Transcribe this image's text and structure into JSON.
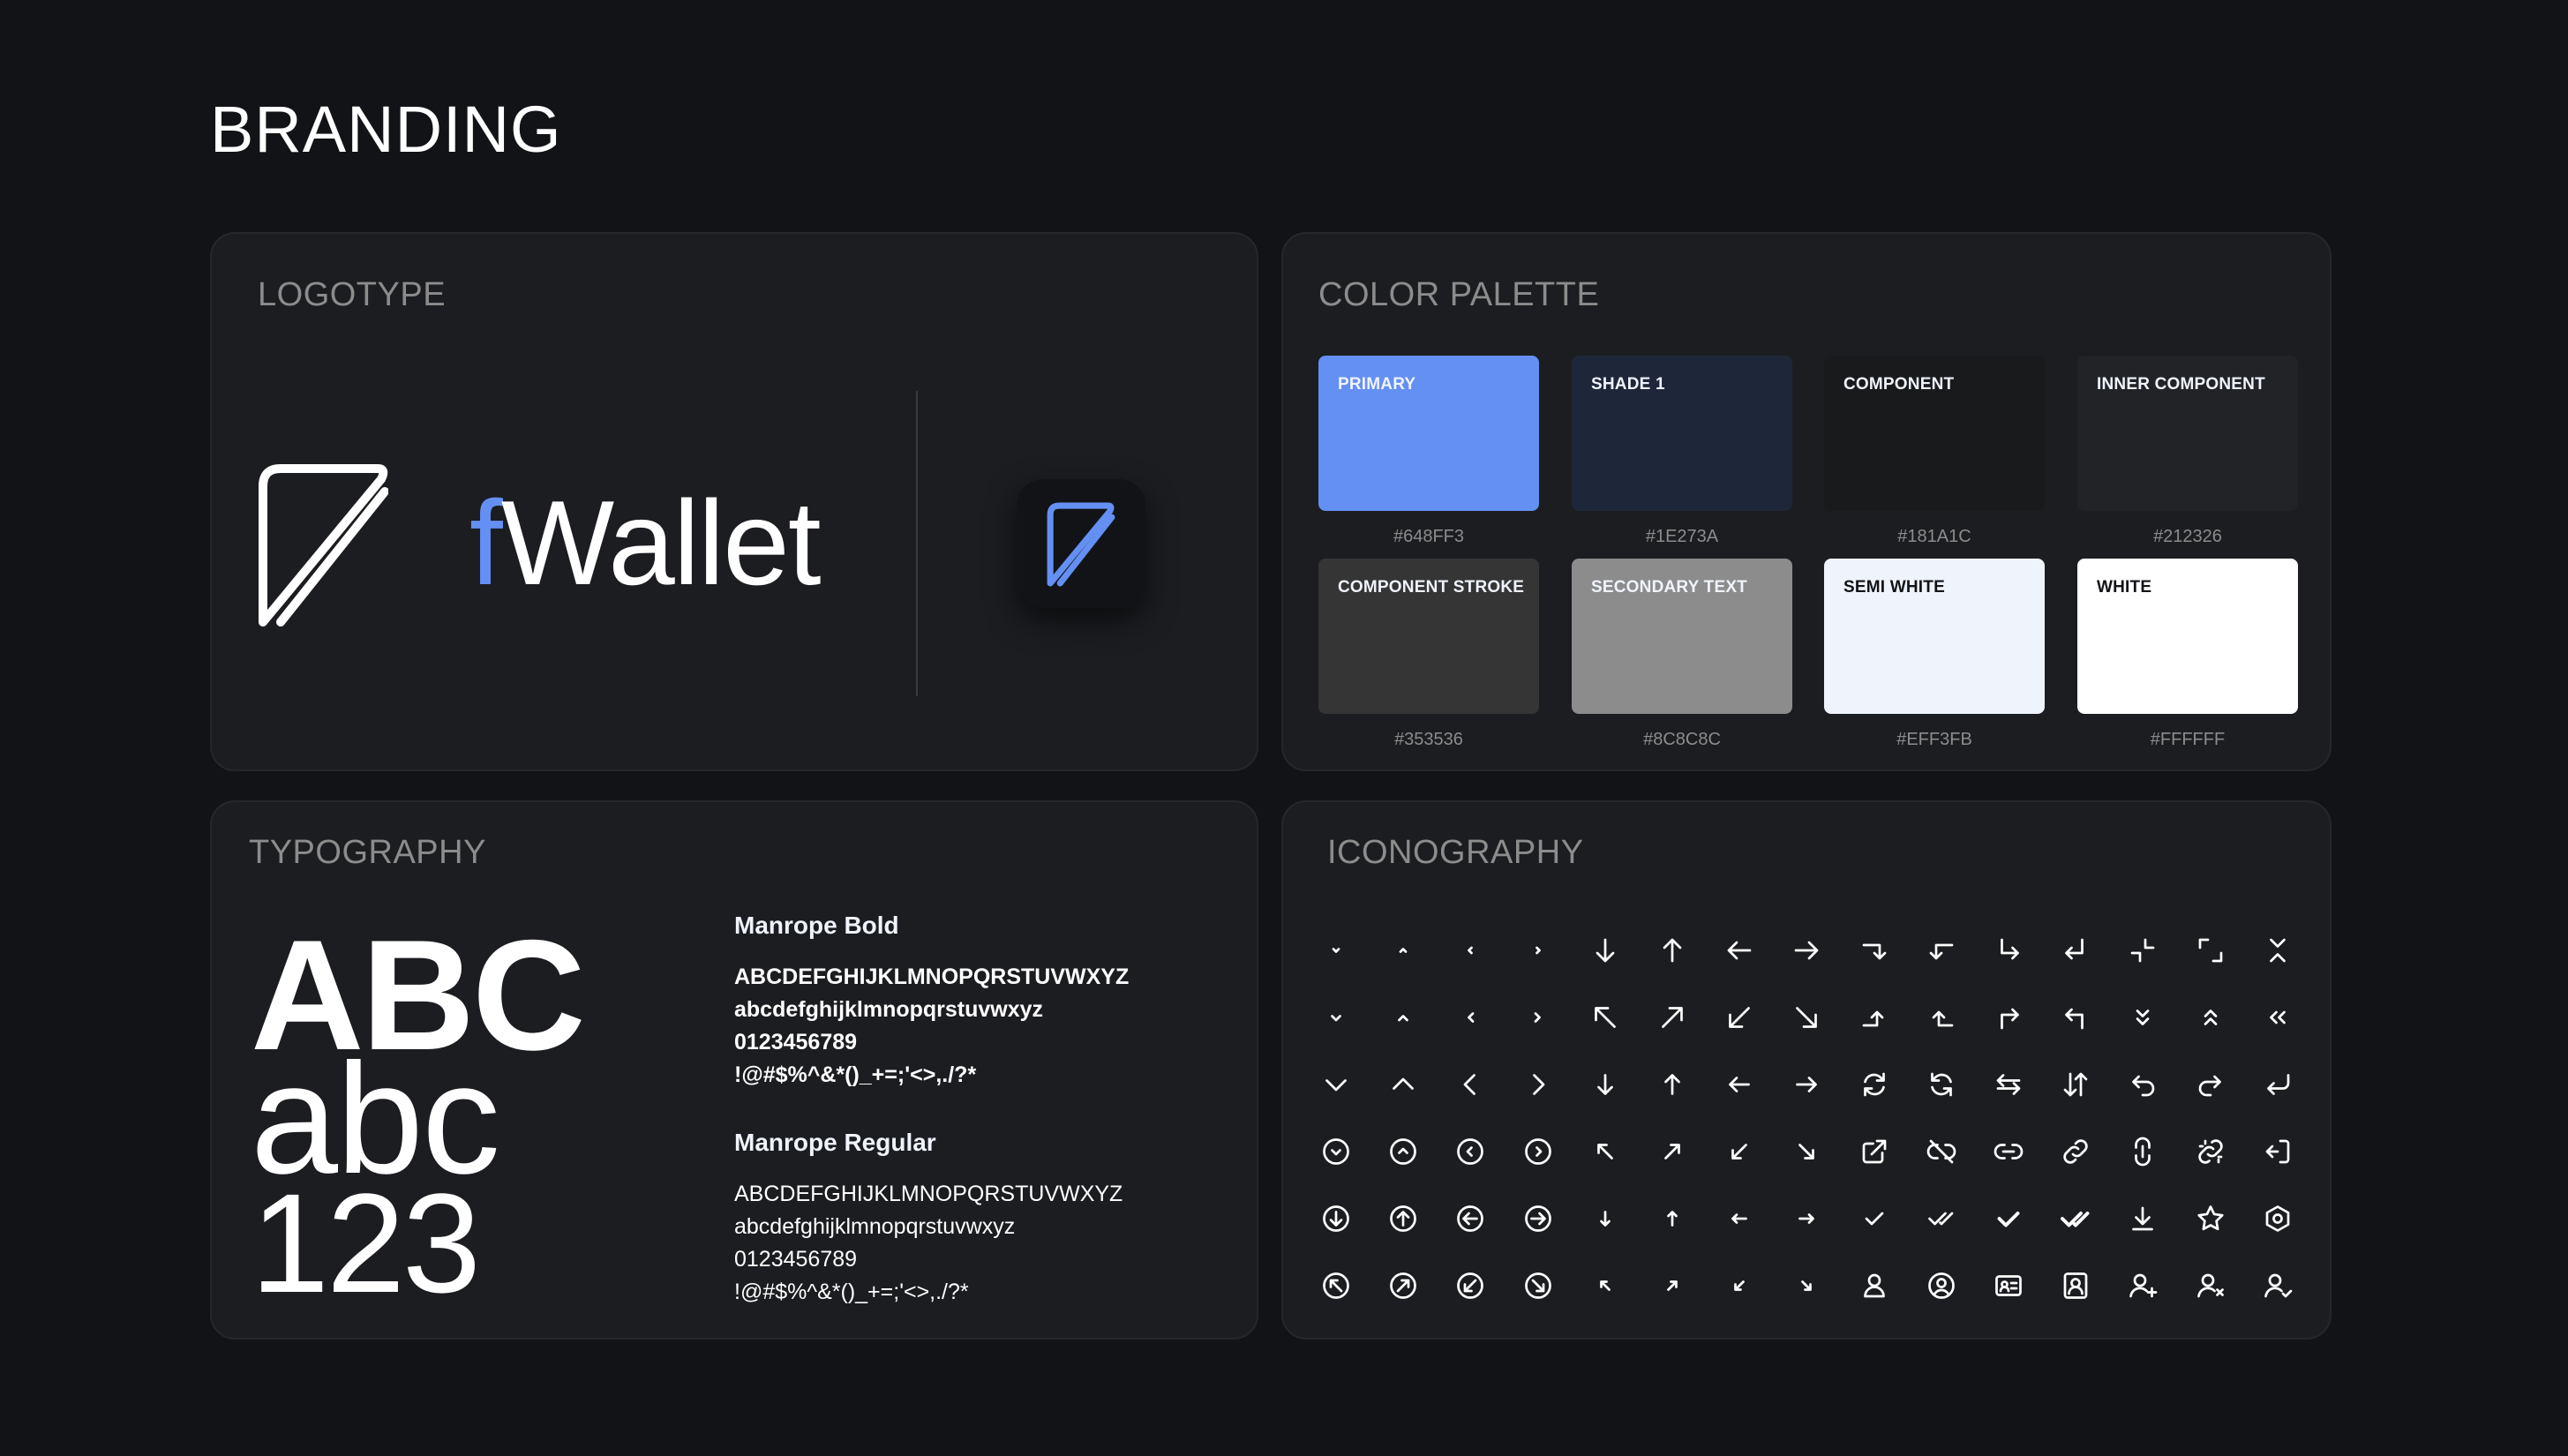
{
  "page": {
    "title": "BRANDING"
  },
  "logotype": {
    "title": "LOGOTYPE",
    "word_f": "f",
    "word_rest": "Wallet"
  },
  "palette": {
    "title": "COLOR PALETTE",
    "swatches": [
      {
        "label": "PRIMARY",
        "hex": "#648FF3",
        "color": "#648FF3",
        "text_color": "#EFF3FB"
      },
      {
        "label": "SHADE 1",
        "hex": "#1E273A",
        "color": "#1E273A",
        "text_color": "#EFF3FB"
      },
      {
        "label": "COMPONENT",
        "hex": "#181A1C",
        "color": "#181A1C",
        "text_color": "#EFF3FB"
      },
      {
        "label": "INNER COMPONENT",
        "hex": "#212326",
        "color": "#212326",
        "text_color": "#EFF3FB"
      },
      {
        "label": "COMPONENT STROKE",
        "hex": "#353536",
        "color": "#353536",
        "text_color": "#EFF3FB"
      },
      {
        "label": "SECONDARY TEXT",
        "hex": "#8C8C8C",
        "color": "#8C8C8C",
        "text_color": "#EFF3FB"
      },
      {
        "label": "SEMI WHITE",
        "hex": "#EFF3FB",
        "color": "#EFF3FB",
        "text_color": "#121317"
      },
      {
        "label": "WHITE",
        "hex": "#FFFFFF",
        "color": "#FFFFFF",
        "text_color": "#121317"
      }
    ]
  },
  "typography": {
    "title": "TYPOGRAPHY",
    "sample_upper": "ABC",
    "sample_lower": "abc",
    "sample_digits": "123",
    "bold": {
      "name": "Manrope Bold",
      "lines": [
        "ABCDEFGHIJKLMNOPQRSTUVWXYZ",
        "abcdefghijklmnopqrstuvwxyz",
        "0123456789",
        "!@#$%^&*()_+=;'<>,./?*"
      ]
    },
    "regular": {
      "name": "Manrope Regular",
      "lines": [
        "ABCDEFGHIJKLMNOPQRSTUVWXYZ",
        "abcdefghijklmnopqrstuvwxyz",
        "0123456789",
        "!@#$%^&*()_+=;'<>,./?*"
      ]
    }
  },
  "iconography": {
    "title": "ICONOGRAPHY",
    "icons": [
      "chevron-down-small-icon",
      "chevron-up-small-icon",
      "chevron-left-small-icon",
      "chevron-right-small-icon",
      "arrow-down-icon",
      "arrow-up-icon",
      "arrow-left-icon",
      "arrow-right-icon",
      "turn-right-down-icon",
      "turn-left-down-icon",
      "corner-down-right-icon",
      "corner-down-left-icon",
      "minimize-icon",
      "maximize-icon",
      "collapse-vertical-icon",
      "chevron-down-icon",
      "chevron-up-icon",
      "chevron-left-icon",
      "chevron-right-icon",
      "arrow-up-left-icon",
      "arrow-up-right-icon",
      "arrow-down-left-icon",
      "arrow-down-right-icon",
      "turn-up-right-icon",
      "turn-up-left-icon",
      "corner-up-right-icon",
      "corner-up-left-icon",
      "chevrons-down-icon",
      "chevrons-up-icon",
      "chevrons-left-icon",
      "chevron-down-large-icon",
      "chevron-up-large-icon",
      "chevron-left-large-icon",
      "chevron-right-large-icon",
      "arrow-down-medium-icon",
      "arrow-up-medium-icon",
      "arrow-left-medium-icon",
      "arrow-right-medium-icon",
      "refresh-icon",
      "refresh-alt-icon",
      "swap-horizontal-icon",
      "swap-vertical-icon",
      "undo-icon",
      "redo-icon",
      "return-icon",
      "chevron-down-circle-icon",
      "chevron-up-circle-icon",
      "chevron-left-circle-icon",
      "chevron-right-circle-icon",
      "arrow-up-left-small-icon",
      "arrow-up-right-small-icon",
      "arrow-down-left-small-icon",
      "arrow-down-right-small-icon",
      "external-link-icon",
      "unlink-icon",
      "link-icon",
      "link-diagonal-icon",
      "link-vertical-icon",
      "link-broken-icon",
      "logout-icon",
      "arrow-down-circle-icon",
      "arrow-up-circle-icon",
      "arrow-left-circle-icon",
      "arrow-right-circle-icon",
      "arrow-down-small-icon",
      "arrow-up-small-icon",
      "arrow-left-small-icon",
      "arrow-right-small-icon",
      "check-icon",
      "check-double-icon",
      "check-bold-icon",
      "check-double-bold-icon",
      "download-icon",
      "star-icon",
      "settings-hexagon-icon",
      "arrow-up-left-circle-icon",
      "arrow-up-right-circle-icon",
      "arrow-down-left-circle-icon",
      "arrow-down-right-circle-icon",
      "arrow-up-left-tiny-icon",
      "arrow-up-right-tiny-icon",
      "arrow-down-left-tiny-icon",
      "arrow-down-right-tiny-icon",
      "user-icon",
      "user-circle-icon",
      "id-card-icon",
      "user-square-icon",
      "user-add-icon",
      "user-remove-icon",
      "user-check-icon"
    ]
  }
}
